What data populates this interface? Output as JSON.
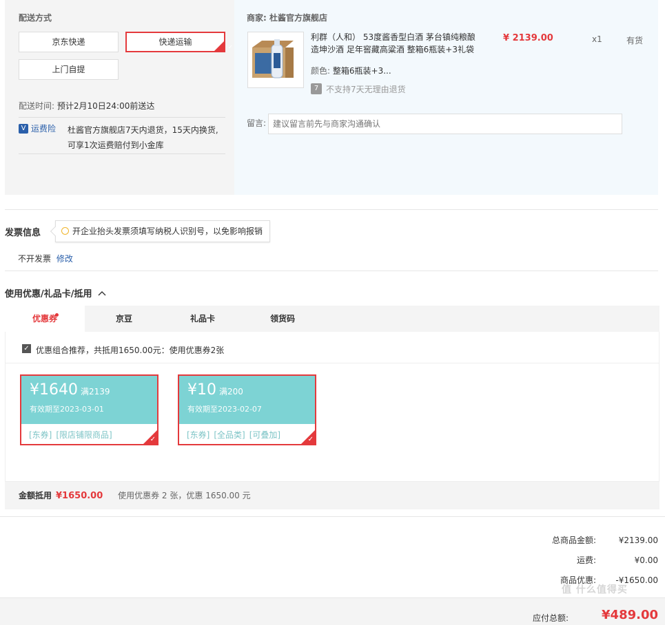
{
  "shipping": {
    "title": "配送方式",
    "options": [
      {
        "label": "京东快递",
        "selected": false
      },
      {
        "label": "快递运输",
        "selected": true
      },
      {
        "label": "上门自提",
        "selected": false
      }
    ],
    "time_label": "配送时间:",
    "time_value": "预计2月10日24:00前送达",
    "insurance_badge": "V",
    "insurance_link": "运费险",
    "insurance_desc_1": "杜酱官方旗舰店7天内退货，15天内换货,",
    "insurance_desc_2": "可享1次运费赔付到小金库"
  },
  "merchant": {
    "label": "商家:",
    "name": "杜酱官方旗舰店",
    "product": {
      "name_1": "利群（人和） 53度酱香型白酒 茅台镇纯粮酿",
      "name_2": "造坤沙酒 足年窖藏高粱酒 整箱6瓶装+3礼袋",
      "price": "¥ 2139.00",
      "qty": "x1",
      "stock": "有货",
      "color_label": "颜色:",
      "color_value": "整箱6瓶装+3...",
      "return_icon": "7",
      "return_text": "不支持7天无理由退货"
    },
    "note_label": "留言:",
    "note_placeholder": "建议留言前先与商家沟通确认"
  },
  "invoice": {
    "title": "发票信息",
    "tip": "开企业抬头发票须填写纳税人识别号，以免影响报销",
    "status": "不开发票",
    "edit": "修改"
  },
  "discount": {
    "title": "使用优惠/礼品卡/抵用",
    "toggle_icon": "chevron-up-icon",
    "tabs": [
      {
        "label": "优惠券",
        "active": true
      },
      {
        "label": "京豆",
        "active": false
      },
      {
        "label": "礼品卡",
        "active": false
      },
      {
        "label": "领货码",
        "active": false
      }
    ],
    "combo_text": "优惠组合推荐，共抵用1650.00元：使用优惠券2张",
    "coupons": [
      {
        "amount": "¥1640",
        "threshold": "满2139",
        "expiry": "有效期至2023-03-01",
        "tags": [
          "[东券]",
          "[限店铺限商品]"
        ]
      },
      {
        "amount": "¥10",
        "threshold": "满200",
        "expiry": "有效期至2023-02-07",
        "tags": [
          "[东券]",
          "[全品类]",
          "[可叠加]"
        ]
      }
    ],
    "summary_label": "金额抵用",
    "summary_amount": "¥1650.00",
    "summary_text": "使用优惠券 2 张，优惠 1650.00 元"
  },
  "totals": {
    "goods_label": "总商品金额:",
    "goods_value": "¥2139.00",
    "shipping_label": "运费:",
    "shipping_value": "¥0.00",
    "discount_label": "商品优惠:",
    "discount_value": "-¥1650.00",
    "pay_label": "应付总额:",
    "pay_value": "¥489.00"
  },
  "watermark": "值 什么值得买"
}
